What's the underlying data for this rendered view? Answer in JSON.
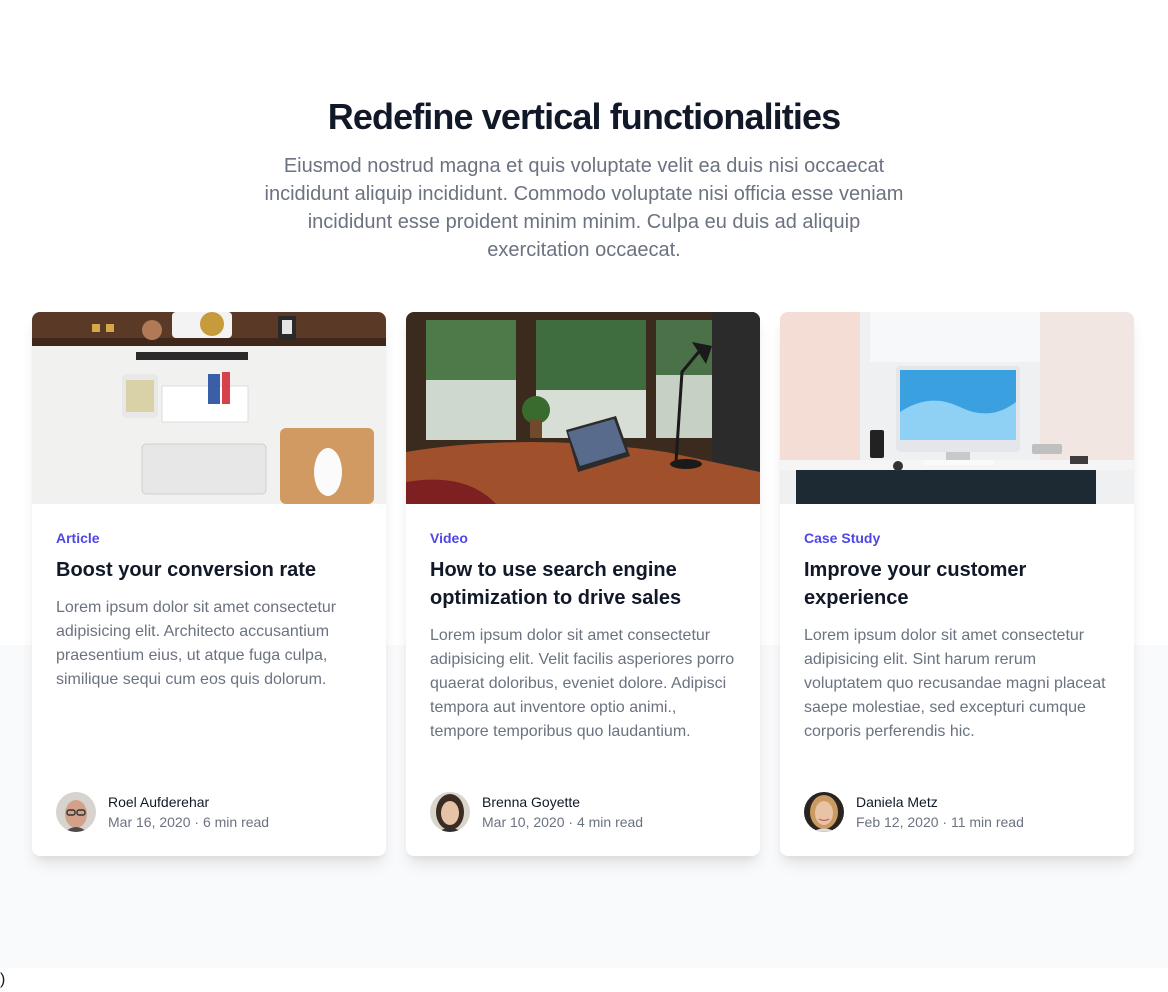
{
  "section": {
    "headline": "Redefine vertical functionalities",
    "lede": "Eiusmod nostrud magna et quis voluptate velit ea duis nisi occaecat incididunt aliquip incididunt. Commodo voluptate nisi officia esse veniam incididunt esse proident minim minim. Culpa eu duis ad aliquip exercitation occaecat."
  },
  "posts": [
    {
      "category": "Article",
      "title": "Boost your conversion rate",
      "description": "Lorem ipsum dolor sit amet consectetur adipisicing elit. Architecto accusantium praesentium eius, ut atque fuga culpa, similique sequi cum eos quis dolorum.",
      "author": "Roel Aufderehar",
      "date": "Mar 16, 2020",
      "separator": "·",
      "read_time": "6 min read",
      "image": "desk-flatlay-photo",
      "avatar": "man-with-glasses-avatar"
    },
    {
      "category": "Video",
      "title": "How to use search engine optimization to drive sales",
      "description": "Lorem ipsum dolor sit amet consectetur adipisicing elit. Velit facilis asperiores porro quaerat doloribus, eveniet dolore. Adipisci tempora aut inventore optio animi., tempore temporibus quo laudantium.",
      "author": "Brenna Goyette",
      "date": "Mar 10, 2020",
      "separator": "·",
      "read_time": "4 min read",
      "image": "window-laptop-photo",
      "avatar": "woman-dark-hair-avatar"
    },
    {
      "category": "Case Study",
      "title": "Improve your customer experience",
      "description": "Lorem ipsum dolor sit amet consectetur adipisicing elit. Sint harum rerum voluptatem quo recusandae magni placeat saepe molestiae, sed excepturi cumque corporis perferendis hic.",
      "author": "Daniela Metz",
      "date": "Feb 12, 2020",
      "separator": "·",
      "read_time": "11 min read",
      "image": "imac-desk-photo",
      "avatar": "woman-blonde-avatar"
    }
  ],
  "footer_stray_text": ")",
  "colors": {
    "accent": "#4f46e5",
    "heading": "#111827",
    "muted": "#6b7280",
    "panel_bg": "#f9fafb"
  }
}
